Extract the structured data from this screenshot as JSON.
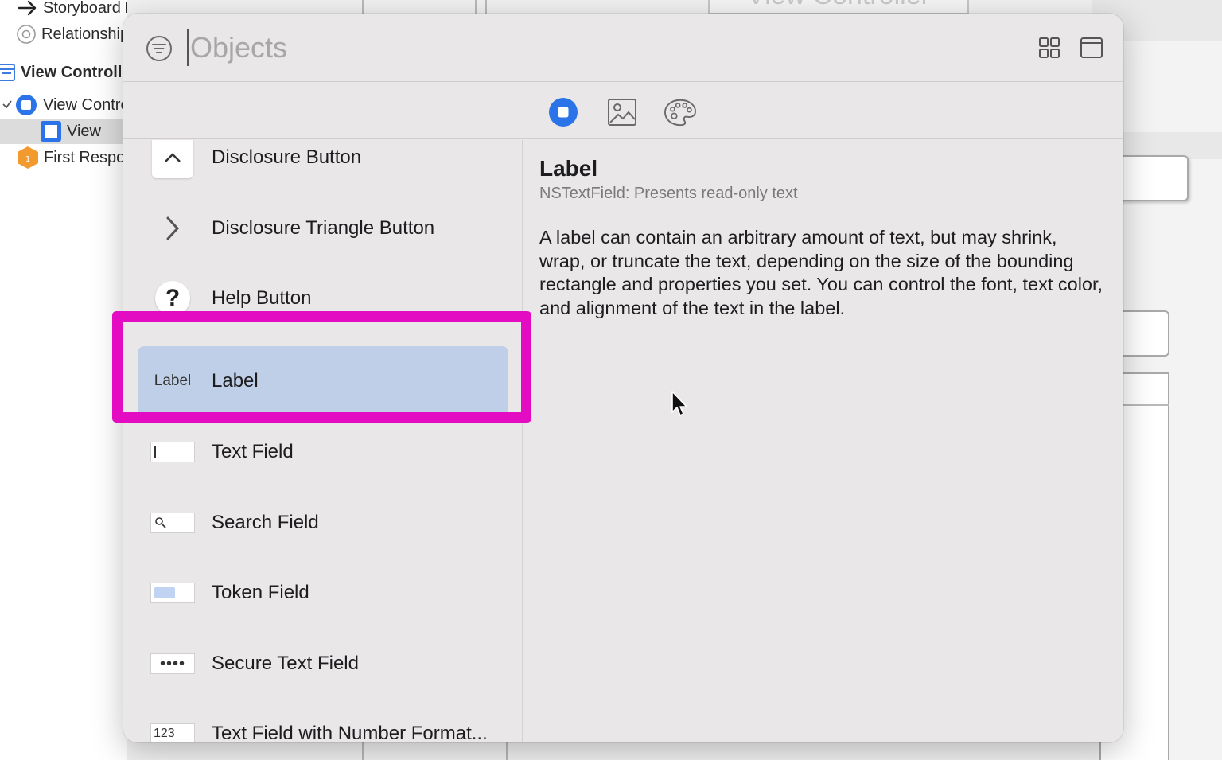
{
  "outline": {
    "items": [
      {
        "label": "Storyboard Entry Point",
        "icon": "arrow-right-icon"
      },
      {
        "label": "Relationship",
        "icon": "relationship-icon"
      },
      {
        "label": "View Controller Scene",
        "icon": "scene-icon"
      },
      {
        "label": "View Controller",
        "icon": "view-controller-icon"
      },
      {
        "label": "View",
        "icon": "view-icon"
      },
      {
        "label": "First Responder",
        "icon": "first-responder-icon"
      }
    ]
  },
  "canvas": {
    "title_ghost": "View Controller"
  },
  "library": {
    "search": {
      "placeholder": "Objects",
      "value": ""
    },
    "header_buttons": [
      "filter-icon",
      "grid-icon",
      "window-icon"
    ],
    "tabs": [
      {
        "icon": "objects-tab-icon",
        "selected": true
      },
      {
        "icon": "image-tab-icon",
        "selected": false
      },
      {
        "icon": "color-palette-tab-icon",
        "selected": false
      }
    ],
    "items": [
      {
        "label": "Disclosure Button",
        "icon": "chevron-up-icon"
      },
      {
        "label": "Disclosure Triangle Button",
        "icon": "chevron-right-icon"
      },
      {
        "label": "Help Button",
        "icon": "help-icon",
        "icon_text": "?"
      },
      {
        "label": "Label",
        "icon": "label-icon",
        "icon_text": "Label",
        "selected": true
      },
      {
        "label": "Text Field",
        "icon": "text-field-icon"
      },
      {
        "label": "Search Field",
        "icon": "search-field-icon"
      },
      {
        "label": "Token Field",
        "icon": "token-field-icon"
      },
      {
        "label": "Secure Text Field",
        "icon": "secure-text-field-icon",
        "icon_text": "••••"
      },
      {
        "label": "Text Field with Number Format...",
        "icon": "number-field-icon",
        "icon_text": "123"
      }
    ],
    "detail": {
      "title": "Label",
      "subtitle": "NSTextField: Presents read-only text",
      "description": "A label can contain an arbitrary amount of text, but may shrink, wrap, or truncate the text, depending on the size of the bounding rectangle and properties you set. You can control the font, text color, and alignment of the text in the label."
    }
  },
  "colors": {
    "highlight": "#e40cc2",
    "selection": "#c0cfe8",
    "accent": "#2a73e8"
  }
}
